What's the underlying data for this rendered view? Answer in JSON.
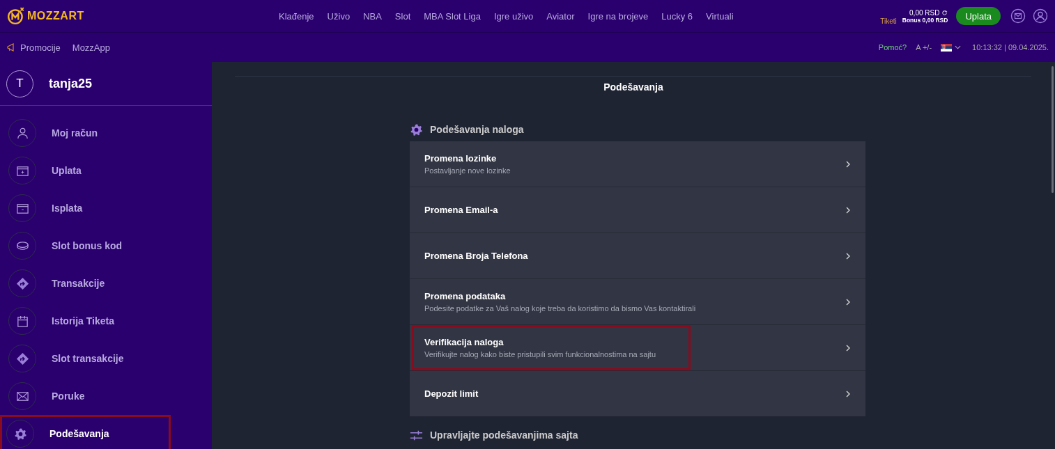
{
  "header": {
    "logo": "MOZZART",
    "nav": [
      "Klađenje",
      "Uživo",
      "NBA",
      "Slot",
      "MBA Slot Liga",
      "Igre uživo",
      "Aviator",
      "Igre na brojeve",
      "Lucky 6",
      "Virtuali"
    ],
    "tickets": "Tiketi",
    "balance": "0,00 RSD",
    "bonus": "Bonus 0,00 RSD",
    "deposit_button": "Uplata"
  },
  "subbar": {
    "links": [
      "Promocije",
      "MozzApp"
    ],
    "help": "Pomoć?",
    "font_size": "A +/-",
    "datetime": "10:13:32 | 09.04.2025."
  },
  "sidebar": {
    "avatar_letter": "T",
    "username": "tanja25",
    "items": [
      {
        "label": "Moj račun",
        "selected": false,
        "highlighted": false
      },
      {
        "label": "Uplata",
        "selected": false,
        "highlighted": false
      },
      {
        "label": "Isplata",
        "selected": false,
        "highlighted": false
      },
      {
        "label": "Slot bonus kod",
        "selected": false,
        "highlighted": false
      },
      {
        "label": "Transakcije",
        "selected": false,
        "highlighted": false
      },
      {
        "label": "Istorija Tiketa",
        "selected": false,
        "highlighted": false
      },
      {
        "label": "Slot transakcije",
        "selected": false,
        "highlighted": false
      },
      {
        "label": "Poruke",
        "selected": false,
        "highlighted": false
      },
      {
        "label": "Podešavanja",
        "selected": true,
        "highlighted": true
      }
    ]
  },
  "page_title": "Podešavanja",
  "sections": [
    {
      "title": "Podešavanja naloga",
      "rows": [
        {
          "title": "Promena lozinke",
          "subtitle": "Postavljanje nove lozinke",
          "highlighted": false
        },
        {
          "title": "Promena Email-a",
          "highlighted": false
        },
        {
          "title": "Promena Broja Telefona",
          "highlighted": false
        },
        {
          "title": "Promena podataka",
          "subtitle": "Podesite podatke za Vaš nalog koje treba da koristimo da bismo Vas kontaktirali",
          "highlighted": false
        },
        {
          "title": "Verifikacija naloga",
          "subtitle": "Verifikujte nalog kako biste pristupili svim funkcionalnostima na sajtu",
          "highlighted": true
        },
        {
          "title": "Depozit limit",
          "highlighted": false
        }
      ]
    },
    {
      "title": "Upravljajte podešavanjima sajta"
    }
  ]
}
